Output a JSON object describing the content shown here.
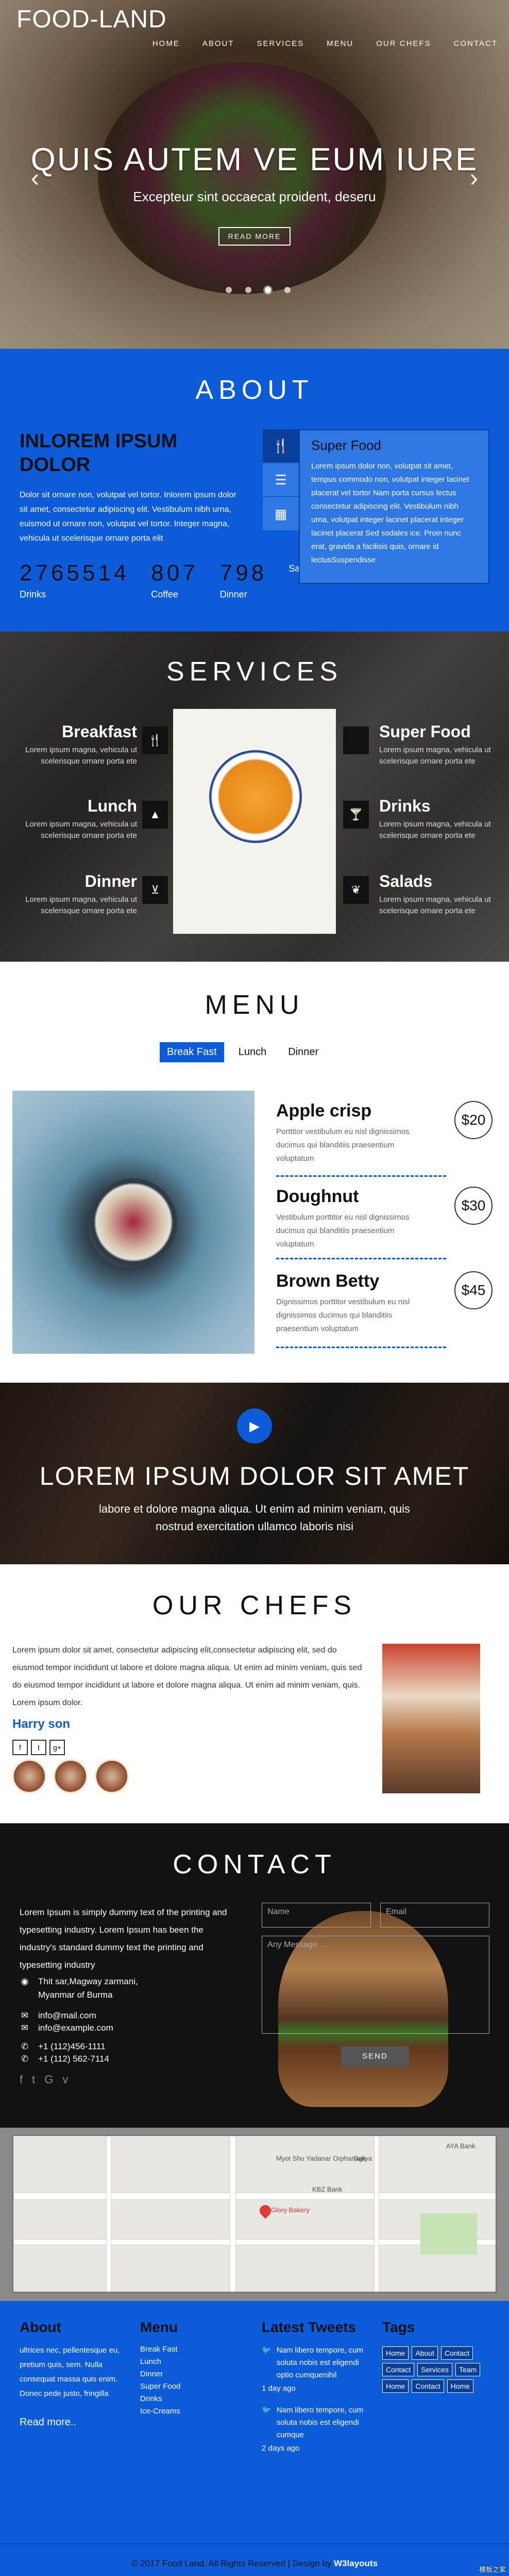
{
  "brand": "FOOD-LAND",
  "nav": [
    "HOME",
    "ABOUT",
    "SERVICES",
    "MENU",
    "OUR CHEFS",
    "CONTACT"
  ],
  "hero": {
    "title": "QUIS AUTEM VE EUM IURE",
    "subtitle": "Excepteur sint occaecat proident, deseru",
    "button": "READ MORE",
    "prev": "‹",
    "next": "›"
  },
  "about": {
    "title": "ABOUT",
    "heading": "INLOREM IPSUM DOLOR",
    "text": "Dolor sit ornare non, volutpat vel tortor. Inlorem ipsum dolor sit amet, consectetur adipiscing elit. Vestibulum nibh urna, euismod ut ornare non, volutpat vel tortor. Integer magna, vehicula ut scelerisque ornare porta elit",
    "stats": [
      {
        "number": "2765514",
        "label": "Drinks"
      },
      {
        "number": "807",
        "label": "Coffee"
      },
      {
        "number": "798",
        "label": "Dinner"
      },
      {
        "number": "",
        "label": "Salads"
      }
    ],
    "tab_icons": [
      "restaurant-icon",
      "list-icon",
      "calendar-icon"
    ],
    "panel_title": "Super Food",
    "panel_text": "Lorem ipsum dolor non, volutpat sit amet, tempus commodo non, volutpat integer lacinet placerat vel tortor Nam porta cursus lectus consectetur adipiscing elit. Vestibulum nibh urna, volutpat integer lacinet placerat integer lacinet placerat Sed sodales ice. Proin nunc erat, gravida a facilisis quis, ornare id lectusSuspendisse"
  },
  "services": {
    "title": "SERVICES",
    "items": [
      {
        "name": "Breakfast",
        "text": "Lorem ipsum magna, vehicula ut scelerisque ornare porta ete",
        "icon": "cutlery-icon"
      },
      {
        "name": "Super Food",
        "text": "Lorem ipsum magna, vehicula ut scelerisque ornare porta ete",
        "icon": "apple-icon"
      },
      {
        "name": "Lunch",
        "text": "Lorem ipsum magna, vehicula ut scelerisque ornare porta ete",
        "icon": "fire-icon"
      },
      {
        "name": "Drinks",
        "text": "Lorem ipsum magna, vehicula ut scelerisque ornare porta ete",
        "icon": "glass-icon"
      },
      {
        "name": "Dinner",
        "text": "Lorem ipsum magna, vehicula ut scelerisque ornare porta ete",
        "icon": "bowl-icon"
      },
      {
        "name": "Salads",
        "text": "Lorem ipsum magna, vehicula ut scelerisque ornare porta ete",
        "icon": "leaf-icon"
      }
    ]
  },
  "menu": {
    "title": "MENU",
    "tabs": [
      "Break Fast",
      "Lunch",
      "Dinner"
    ],
    "items": [
      {
        "name": "Apple crisp",
        "desc": "Porttitor vestibulum eu nisl dignissimos ducimus qui blanditiis praesentium voluptatum",
        "price": "$20"
      },
      {
        "name": "Doughnut",
        "desc": "Vestibulum porttitor eu nisl dignissimos ducimus qui blanditiis praesentium voluptatum",
        "price": "$30"
      },
      {
        "name": "Brown Betty",
        "desc": "Dignissimos porttitor vestibulum eu nisl dignissimos ducimus qui blanditiis praesentium voluptatum",
        "price": "$45"
      }
    ]
  },
  "video": {
    "title": "LOREM IPSUM DOLOR SIT AMET",
    "text": "labore et dolore magna aliqua. Ut enim ad minim veniam, quis nostrud exercitation ullamco laboris nisi"
  },
  "chefs": {
    "title": "OUR CHEFS",
    "text": "Lorem ipsum dolor sit amet, consectetur adipiscing elit,consectetur adipiscing elit, sed do eiusmod tempor incididunt ut labore et dolore magna aliqua. Ut enim ad minim veniam, quis sed do eiusmod tempor incididunt ut labore et dolore magna aliqua. Ut enim ad minim veniam, quis. Lorem ipsum dolor.",
    "name": "Harry son",
    "social": [
      "f",
      "t",
      "g+"
    ]
  },
  "contact": {
    "title": "CONTACT",
    "text": "Lorem Ipsum is simply dummy text of the printing and typesetting industry. Lorem Ipsum has been the industry's standard dummy text the printing and typesetting industry",
    "address": "Thit sar,Magway zarmani, Myanmar of Burma",
    "emails": [
      "info@mail.com",
      "info@example.com"
    ],
    "phones": [
      "+1 (112)456-1111",
      "+1 (112) 562-7114"
    ],
    "name_placeholder": "Name",
    "email_placeholder": "Email",
    "message_placeholder": "Any Message....",
    "send": "SEND"
  },
  "map": {
    "labels": [
      "Myot Shu Yadanar Orphanage",
      "Glory Bakery",
      "KBZ Bank",
      "AYA Bank",
      "Daliya"
    ]
  },
  "footer": {
    "about_title": "About",
    "about_text": "ultrices nec, pellentesque eu, pretium quis, sem. Nulla consequat massa quis enim. Donec pede justo, fringilla",
    "read_more": "Read more..",
    "menu_title": "Menu",
    "menu_items": [
      "Break Fast",
      "Lunch",
      "Dinner",
      "Super Food",
      "Drinks",
      "Ice-Creams"
    ],
    "tweets_title": "Latest Tweets",
    "tweets": [
      {
        "text": "Nam libero tempore, cum soluta nobis est eligendi optio cumquenihil",
        "time": "1 day ago"
      },
      {
        "text": "Nam libero tempore, cum soluta nobis est eligendi cumque",
        "time": "2 days ago"
      }
    ],
    "tags_title": "Tags",
    "tags": [
      "Home",
      "About",
      "Contact",
      "Contact",
      "Services",
      "Team",
      "Home",
      "Contact",
      "Home"
    ],
    "copyright": "© 2017 Food Land. All Rights Reserved | Design by",
    "designer": "W3layouts"
  },
  "watermark": "模板之家",
  "colors": {
    "accent": "#0c5bd8",
    "dark": "#111111"
  }
}
